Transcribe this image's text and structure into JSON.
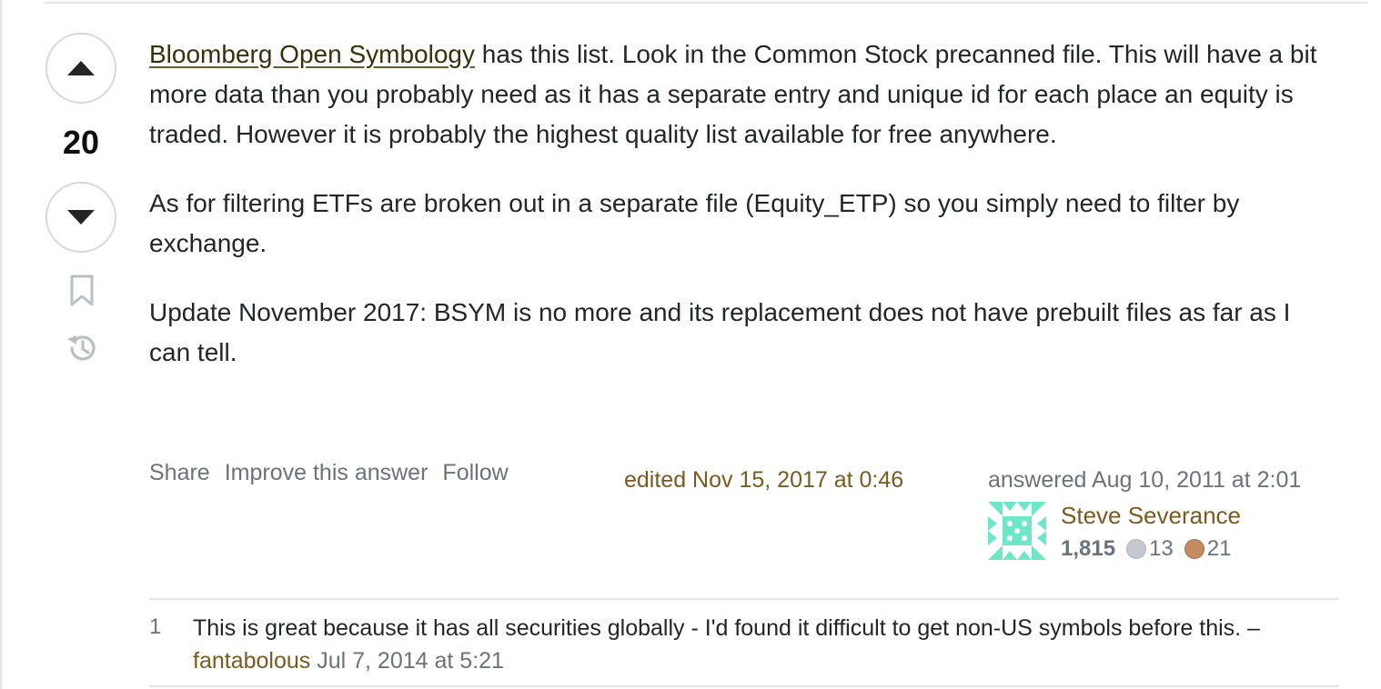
{
  "vote": {
    "count": "20",
    "upvote_icon": "triangle-up-icon",
    "downvote_icon": "triangle-down-icon",
    "bookmark_icon": "bookmark-icon",
    "history_icon": "history-icon"
  },
  "post": {
    "link_text": "Bloomberg Open Symbology",
    "paragraph1_rest": " has this list. Look in the Common Stock precanned file. This will have a bit more data than you probably need as it has a separate entry and unique id for each place an equity is traded. However it is probably the highest quality list available for free anywhere.",
    "paragraph2": "As for filtering ETFs are broken out in a separate file (Equity_ETP) so you simply need to filter by exchange.",
    "paragraph3": "Update November 2017: BSYM is no more and its replacement does not have prebuilt files as far as I can tell."
  },
  "menu": {
    "share": "Share",
    "improve": "Improve this answer",
    "follow": "Follow"
  },
  "edited": "edited Nov 15, 2017 at 0:46",
  "answered": "answered Aug 10, 2011 at 2:01",
  "user": {
    "name": "Steve Severance",
    "reputation": "1,815",
    "silver_badges": "13",
    "bronze_badges": "21",
    "avatar_color": "#6ee6c8"
  },
  "comment": {
    "score": "1",
    "text": "This is great because it has all securities globally - I'd found it difficult to get non-US symbols before this. – ",
    "user": "fantabolous",
    "date": "Jul 7, 2014 at 5:21"
  },
  "colors": {
    "link": "#3b2f0b",
    "user_link": "#7a5a1e",
    "muted": "#6a737c",
    "text": "#232629"
  }
}
